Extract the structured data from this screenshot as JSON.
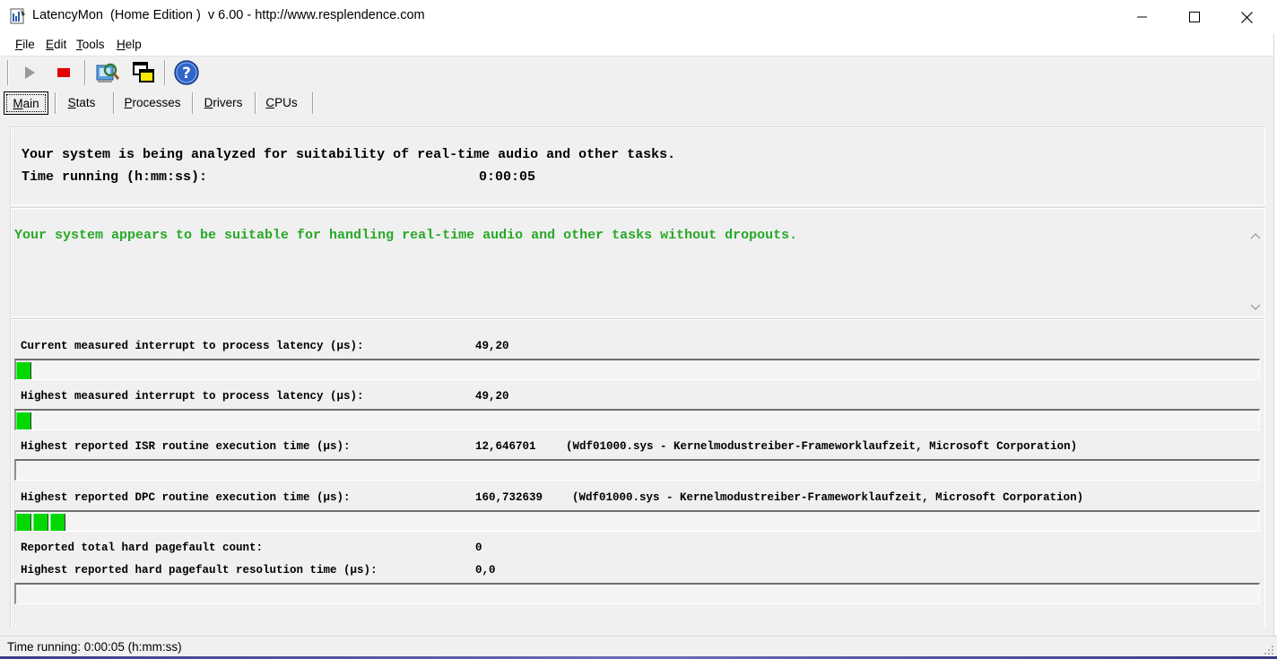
{
  "window": {
    "title": "LatencyMon  (Home Edition )  v 6.00 - http://www.resplendence.com",
    "minimize": "minimize",
    "maximize": "maximize",
    "close": "close"
  },
  "menu": {
    "file": {
      "mnemonic": "F",
      "rest": "ile"
    },
    "edit": {
      "mnemonic": "E",
      "rest": "dit"
    },
    "tools": {
      "mnemonic": "T",
      "rest": "ools"
    },
    "help": {
      "mnemonic": "H",
      "rest": "elp"
    }
  },
  "toolbar": {
    "icons": [
      "play-icon",
      "stop-icon",
      "analyze-icon",
      "windows-icon",
      "help-icon"
    ]
  },
  "tabs": [
    {
      "mnemonic": "M",
      "rest": "ain"
    },
    {
      "mnemonic": "S",
      "rest": "tats"
    },
    {
      "mnemonic": "P",
      "rest": "rocesses"
    },
    {
      "mnemonic": "D",
      "rest": "rivers"
    },
    {
      "mnemonic": "C",
      "rest": "PUs"
    }
  ],
  "analysis": {
    "status_line": "Your system is being analyzed for suitability of real-time audio and other tasks.",
    "time_label": "Time running (h:mm:ss):",
    "time_value": "0:00:05"
  },
  "verdict": {
    "message": "Your system appears to be suitable for handling real-time audio and other tasks without dropouts.",
    "color": "#27a827"
  },
  "stats": {
    "current_latency": {
      "label": "Current measured interrupt to process latency (µs):",
      "value": "49,20",
      "bar_segments": 1
    },
    "highest_latency": {
      "label": "Highest measured interrupt to process latency (µs):",
      "value": "49,20",
      "bar_segments": 1
    },
    "isr": {
      "label": "Highest reported ISR routine execution time (µs):",
      "value": "12,646701",
      "detail": "(Wdf01000.sys - Kernelmodustreiber-Frameworklaufzeit, Microsoft Corporation)",
      "bar_segments": 0
    },
    "dpc": {
      "label": "Highest reported DPC routine execution time (µs):",
      "value": "160,732639",
      "detail": "(Wdf01000.sys - Kernelmodustreiber-Frameworklaufzeit, Microsoft Corporation)",
      "bar_segments": 3
    },
    "pagefault_count": {
      "label": "Reported total hard pagefault count:",
      "value": "0"
    },
    "pagefault_time": {
      "label": "Highest reported hard pagefault resolution time (µs):",
      "value": "0,0",
      "bar_segments": 0
    }
  },
  "statusbar": {
    "text": "Time running: 0:00:05  (h:mm:ss)"
  },
  "colors": {
    "bar_fill": "#00d800",
    "verdict": "#27a827"
  }
}
